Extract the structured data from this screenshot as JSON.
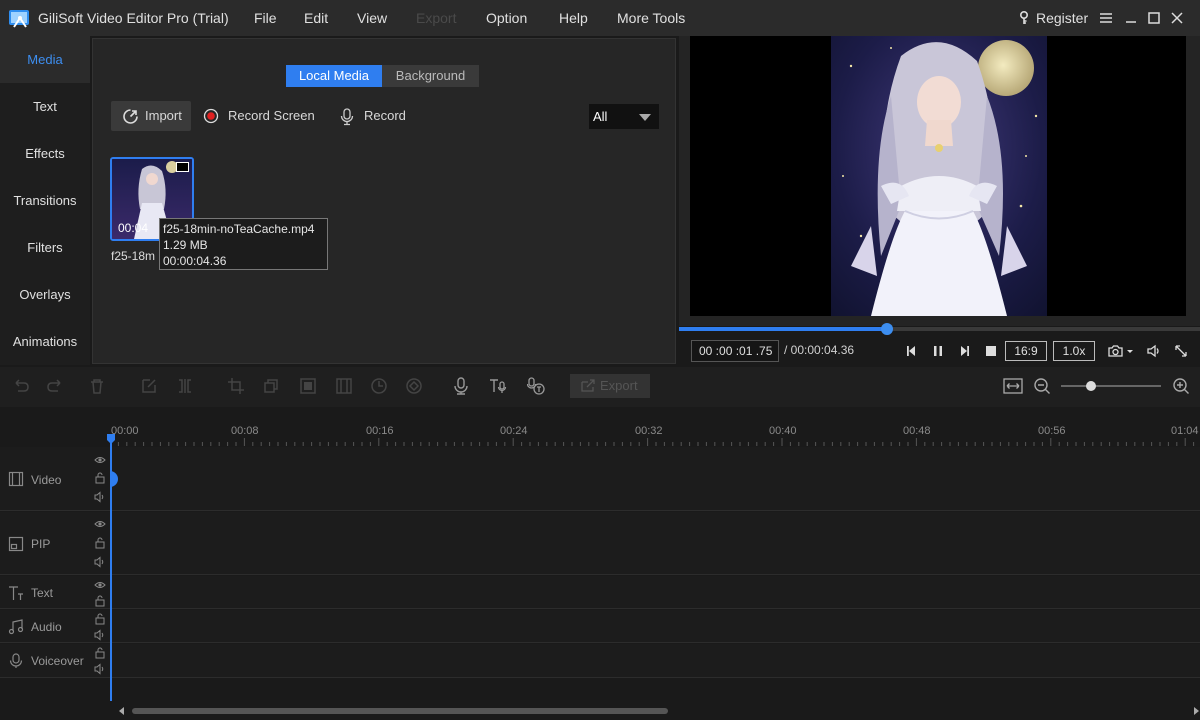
{
  "app": {
    "title": "GiliSoft Video Editor Pro (Trial)",
    "menu": [
      "File",
      "Edit",
      "View",
      "Export",
      "Option",
      "Help",
      "More Tools"
    ],
    "register": "Register"
  },
  "left_tabs": [
    "Media",
    "Text",
    "Effects",
    "Transitions",
    "Filters",
    "Overlays",
    "Animations"
  ],
  "media_panel": {
    "tabs": [
      "Local Media",
      "Background"
    ],
    "import": "Import",
    "record_screen": "Record Screen",
    "record": "Record",
    "filter": "All",
    "item": {
      "duration": "00:04",
      "name_short": "f25-18m",
      "tooltip_name": "f25-18min-noTeaCache.mp4",
      "tooltip_size": "1.29 MB",
      "tooltip_duration": "00:00:04.36"
    }
  },
  "preview": {
    "current_time": "00 :00 :01 .75",
    "total_time": "/ 00:00:04.36",
    "aspect": "16:9",
    "speed": "1.0x",
    "progress_fraction": 0.4
  },
  "toolbar": {
    "export": "Export",
    "zoom_fraction": 0.3
  },
  "timeline": {
    "ticks": [
      "00:00",
      "00:08",
      "00:16",
      "00:24",
      "00:32",
      "00:40",
      "00:48",
      "00:56",
      "01:04"
    ],
    "tracks": [
      "Video",
      "PIP",
      "Text",
      "Audio",
      "Voiceover"
    ]
  },
  "colors": {
    "accent": "#2f7ef0"
  }
}
